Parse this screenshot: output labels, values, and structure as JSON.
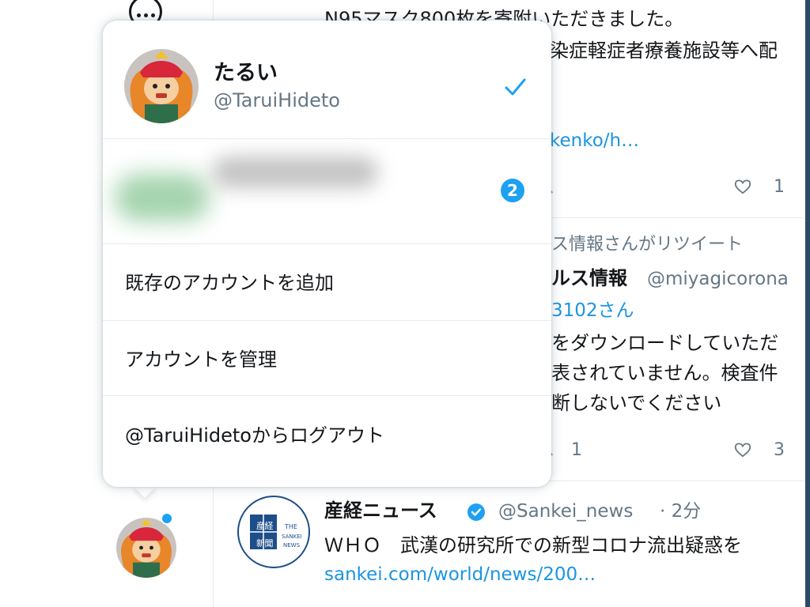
{
  "timeline": {
    "tweet1_line1": "N95マスク800枚を寄附いただきました。",
    "tweet1_line2": "染症軽症者療養施設等へ配",
    "tweet1_link": "kenko/h…",
    "tweet1_like_count": "1",
    "retweet_context": "ス情報さんがリツイート",
    "tweet2_name": "ルス情報",
    "tweet2_handle": "@miyagicorona",
    "tweet2_mention": "3102さん",
    "tweet2_line1": "をダウンロードしていただ",
    "tweet2_line2": "表されていません。検査件",
    "tweet2_line3": "断しないでください",
    "tweet2_retweet_count": "1",
    "tweet2_like_count": "3",
    "tweet3_name": "産経ニュース",
    "tweet3_handle": "@Sankei_news",
    "tweet3_time": "· 2分",
    "tweet3_text": "ＷＨＯ　武漢の研究所での新型コロナ流出疑惑を",
    "tweet3_link": "sankei.com/world/news/200…",
    "sankei_logo_text_left": "産経新聞",
    "sankei_logo_text_right": "THE SANKEI NEWS"
  },
  "account_menu": {
    "current_name": "たるい",
    "current_handle": "@TaruiHideto",
    "other_account_badge": "2",
    "add_existing": "既存のアカウントを追加",
    "manage_accounts": "アカウントを管理",
    "logout": "@TaruiHidetoからログアウト"
  },
  "colors": {
    "accent": "#1da1f2",
    "link": "#1b95e0",
    "muted": "#657786"
  }
}
